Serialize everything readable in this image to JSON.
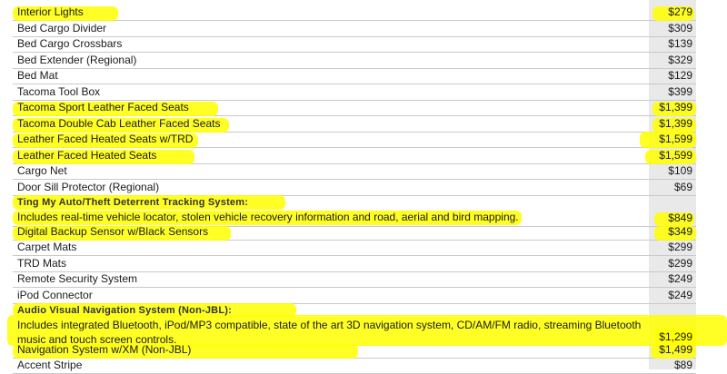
{
  "top_partial_text": "",
  "rows": [
    {
      "name": "Interior Lights",
      "price": "$279",
      "highlight": true
    },
    {
      "name": "Bed Cargo Divider",
      "price": "$309",
      "highlight": false
    },
    {
      "name": "Bed Cargo Crossbars",
      "price": "$139",
      "highlight": false
    },
    {
      "name": "Bed Extender (Regional)",
      "price": "$329",
      "highlight": false
    },
    {
      "name": "Bed Mat",
      "price": "$129",
      "highlight": false
    },
    {
      "name": "Tacoma Tool Box",
      "price": "$399",
      "highlight": false
    },
    {
      "name": "Tacoma Sport Leather Faced Seats",
      "price": "$1,399",
      "highlight": true
    },
    {
      "name": "Tacoma Double Cab Leather Faced Seats",
      "price": "$1,399",
      "highlight": true
    },
    {
      "name": "Leather Faced Heated Seats w/TRD",
      "price": "$1,599",
      "highlight": true
    },
    {
      "name": "Leather Faced Heated Seats",
      "price": "$1,599",
      "highlight": true
    },
    {
      "name": "Cargo Net",
      "price": "$109",
      "highlight": false
    },
    {
      "name": "Door Sill Protector (Regional)",
      "price": "$69",
      "highlight": false
    },
    {
      "name": "Ting My Auto/Theft Deterrent Tracking System:",
      "description": "Includes real-time vehicle locator, stolen vehicle recovery information and road, aerial and bird mapping.",
      "price": "$849",
      "highlight": true
    },
    {
      "name": "Digital Backup Sensor w/Black Sensors",
      "price": "$349",
      "highlight": true
    },
    {
      "name": "Carpet Mats",
      "price": "$299",
      "highlight": false
    },
    {
      "name": "TRD Mats",
      "price": "$299",
      "highlight": false
    },
    {
      "name": "Remote Security System",
      "price": "$249",
      "highlight": false
    },
    {
      "name": "iPod Connector",
      "price": "$249",
      "highlight": false
    },
    {
      "name": "Audio Visual Navigation System (Non-JBL):",
      "description": "Includes integrated Bluetooth, iPod/MP3 compatible, state of the art 3D navigation system, CD/AM/FM radio, streaming Bluetooth music and touch screen controls.",
      "price": "$1,299",
      "highlight": true
    },
    {
      "name": "Navigation System w/XM (Non-JBL)",
      "price": "$1,499",
      "highlight": true
    },
    {
      "name": "Accent Stripe",
      "price": "$89",
      "highlight": false
    }
  ],
  "colors": {
    "highlight": "#ffff00",
    "price_column": "#e9e9e9",
    "rule": "#c9c9c9"
  }
}
